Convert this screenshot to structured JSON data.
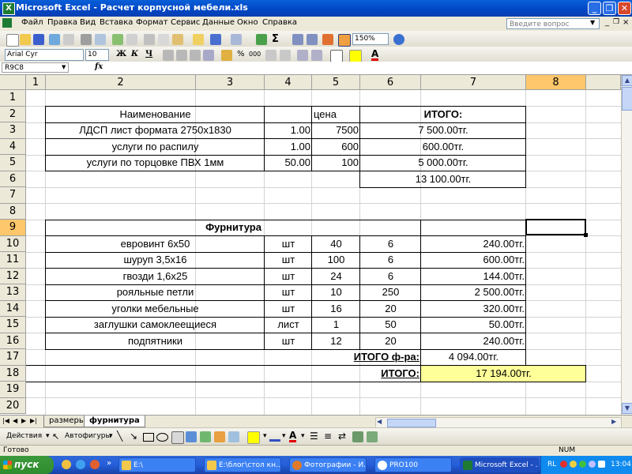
{
  "window": {
    "title": "Microsoft Excel - Расчет корпусной мебели.xls"
  },
  "menu": {
    "items": [
      "Файл",
      "Правка",
      "Вид",
      "Вставка",
      "Формат",
      "Сервис",
      "Данные",
      "Окно",
      "Справка"
    ],
    "ask_placeholder": "Введите вопрос"
  },
  "toolbar": {
    "zoom": "150%"
  },
  "format_toolbar": {
    "font": "Arial Cyr",
    "size": "10",
    "bold": "Ж",
    "italic": "К",
    "underline": "Ч",
    "percent": "%",
    "thousands": "000"
  },
  "formula_bar": {
    "name_box": "R9C8",
    "fx": "fx",
    "formula": ""
  },
  "columns": [
    "1",
    "2",
    "3",
    "4",
    "5",
    "6",
    "7",
    "8"
  ],
  "active_column": "8",
  "rows": [
    "1",
    "2",
    "3",
    "4",
    "5",
    "6",
    "7",
    "8",
    "9",
    "10",
    "11",
    "12",
    "13",
    "14",
    "15",
    "16",
    "17",
    "18",
    "19",
    "20"
  ],
  "active_row": "9",
  "table1": {
    "header": {
      "name": "Наименование",
      "price": "цена",
      "total": "ИТОГО:"
    },
    "items": [
      {
        "name": "ЛДСП лист формата 2750х1830",
        "qty": "1.00",
        "price": "7500",
        "total": "7 500.00тг."
      },
      {
        "name": "услуги по распилу",
        "qty": "1.00",
        "price": "600",
        "total": "600.00тг."
      },
      {
        "name": "услуги по торцовке ПВХ 1мм",
        "qty": "50.00",
        "price": "100",
        "total": "5 000.00тг."
      }
    ],
    "sum": "13 100.00тг."
  },
  "table2": {
    "title": "Фурнитура",
    "items": [
      {
        "name": "евровинт 6х50",
        "unit": "шт",
        "qty": "40",
        "price": "6",
        "total": "240.00тг."
      },
      {
        "name": "шуруп 3,5х16",
        "unit": "шт",
        "qty": "100",
        "price": "6",
        "total": "600.00тг."
      },
      {
        "name": "гвозди 1,6х25",
        "unit": "шт",
        "qty": "24",
        "price": "6",
        "total": "144.00тг."
      },
      {
        "name": "рояльные петли",
        "unit": "шт",
        "qty": "10",
        "price": "250",
        "total": "2 500.00тг."
      },
      {
        "name": "уголки мебельные",
        "unit": "шт",
        "qty": "16",
        "price": "20",
        "total": "320.00тг."
      },
      {
        "name": "заглушки самоклеещиеся",
        "unit": "лист",
        "qty": "1",
        "price": "50",
        "total": "50.00тг."
      },
      {
        "name": "подпятники",
        "unit": "шт",
        "qty": "12",
        "price": "20",
        "total": "240.00тг."
      }
    ],
    "subtotal_label": "ИТОГО ф-ра:",
    "subtotal": "4 094.00тг.",
    "total_label": "ИТОГО:",
    "total": "17 194.00тг.",
    "total_fill": "#ffff99"
  },
  "tabs": [
    {
      "label": "размеры",
      "active": false
    },
    {
      "label": "фурнитура",
      "active": true
    }
  ],
  "drawing_toolbar": {
    "actions": "Действия",
    "autoshapes": "Автофигуры"
  },
  "status": {
    "text": "Готово",
    "num": "NUM"
  },
  "taskbar": {
    "start": "пуск",
    "tasks": [
      {
        "label": "E:\\",
        "active": false
      },
      {
        "label": "E:\\блог\\стол кн...",
        "active": false
      },
      {
        "label": "Фотографии - И...",
        "active": false
      },
      {
        "label": "PRO100",
        "active": false
      },
      {
        "label": "Microsoft Excel - ...",
        "active": true
      }
    ],
    "lang": "RL",
    "clock": "13:04"
  },
  "colors": {
    "title_blue": "#0146c4",
    "active_header": "#ffc76b",
    "total_fill": "#ffff99",
    "taskbar": "#245edb",
    "start_green": "#2e8b2e"
  }
}
